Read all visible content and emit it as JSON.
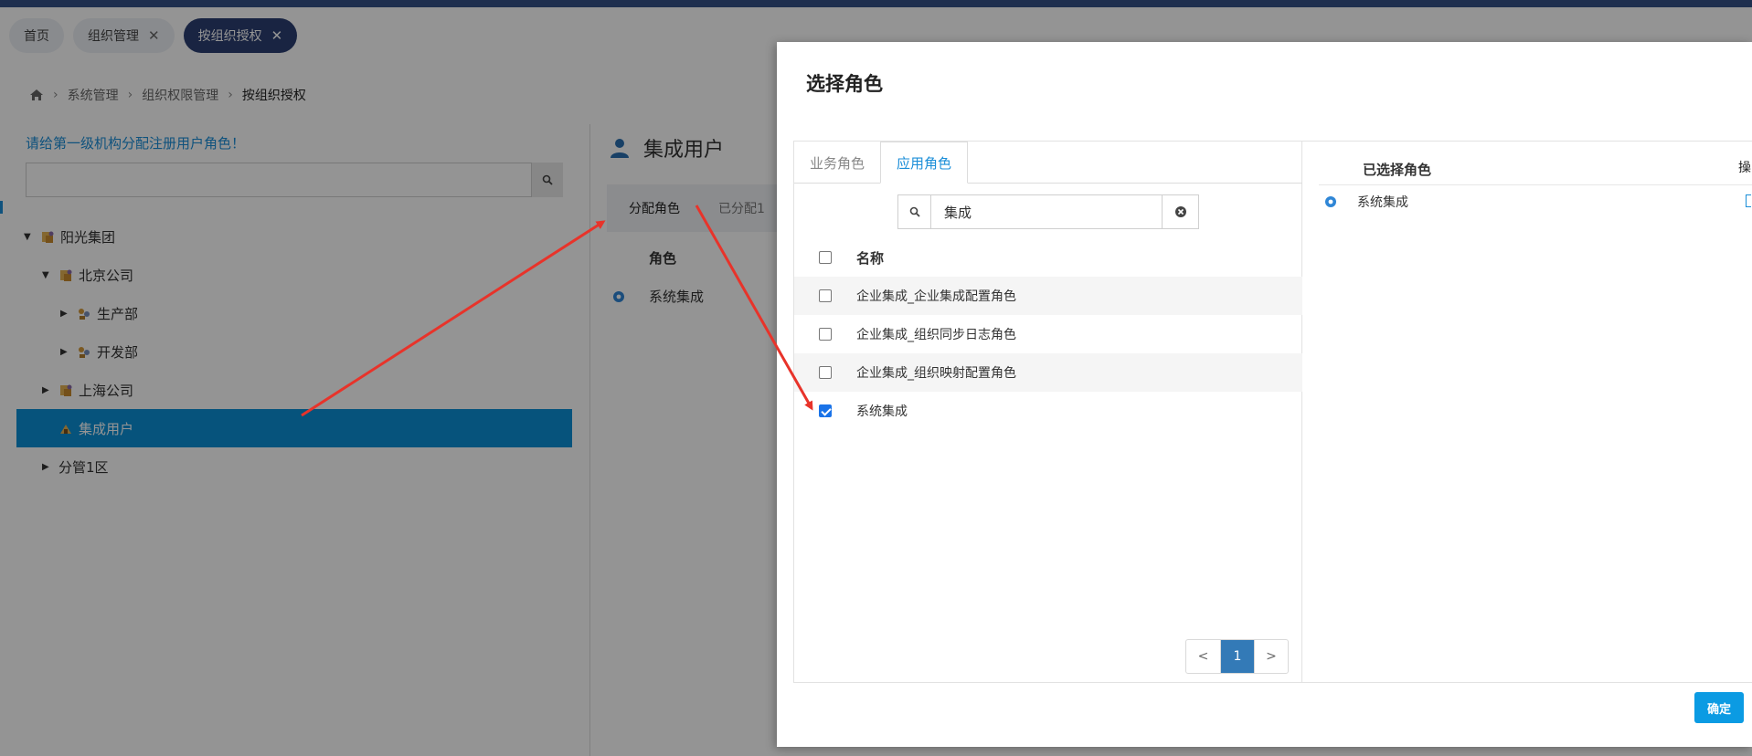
{
  "tabs": [
    {
      "label": "首页",
      "closable": false,
      "active": false
    },
    {
      "label": "组织管理",
      "closable": true,
      "active": false
    },
    {
      "label": "按组织授权",
      "closable": true,
      "active": true
    }
  ],
  "breadcrumb": {
    "items": [
      "系统管理",
      "组织权限管理",
      "按组织授权"
    ]
  },
  "left": {
    "tip": "请给第一级机构分配注册用户角色！",
    "search_placeholder": "",
    "tree": [
      {
        "label": "阳光集团",
        "level": 0,
        "expanded": true,
        "selected": false
      },
      {
        "label": "北京公司",
        "level": 1,
        "expanded": true,
        "selected": false
      },
      {
        "label": "生产部",
        "level": 2,
        "expanded": false,
        "selected": false
      },
      {
        "label": "开发部",
        "level": 2,
        "expanded": false,
        "selected": false
      },
      {
        "label": "上海公司",
        "level": 1,
        "expanded": false,
        "selected": false
      },
      {
        "label": "集成用户",
        "level": 1,
        "expanded": null,
        "selected": true
      },
      {
        "label": "分管1区",
        "level": 1,
        "expanded": false,
        "selected": false
      }
    ]
  },
  "right": {
    "title": "集成用户",
    "tabs": [
      "分配角色",
      "已分配1"
    ],
    "column": "角色",
    "rows": [
      "系统集成"
    ]
  },
  "modal": {
    "title": "选择角色",
    "tabs": [
      {
        "label": "业务角色",
        "active": false
      },
      {
        "label": "应用角色",
        "active": true
      }
    ],
    "search_value": "集成",
    "table_header": "名称",
    "rows": [
      {
        "name": "企业集成_企业集成配置角色",
        "checked": false
      },
      {
        "name": "企业集成_组织同步日志角色",
        "checked": false
      },
      {
        "name": "企业集成_组织映射配置角色",
        "checked": false
      },
      {
        "name": "系统集成",
        "checked": true
      }
    ],
    "pager": {
      "prev": "<",
      "page": "1",
      "next": ">"
    },
    "selected_header": "已选择角色",
    "selected_extra": "操",
    "selected_rows": [
      "系统集成"
    ],
    "confirm_label": "确定"
  },
  "colors": {
    "accent": "#0b8fd6",
    "tab_active": "#2b3f72",
    "arrow": "#e8332a",
    "pager_active": "#337ab7"
  }
}
